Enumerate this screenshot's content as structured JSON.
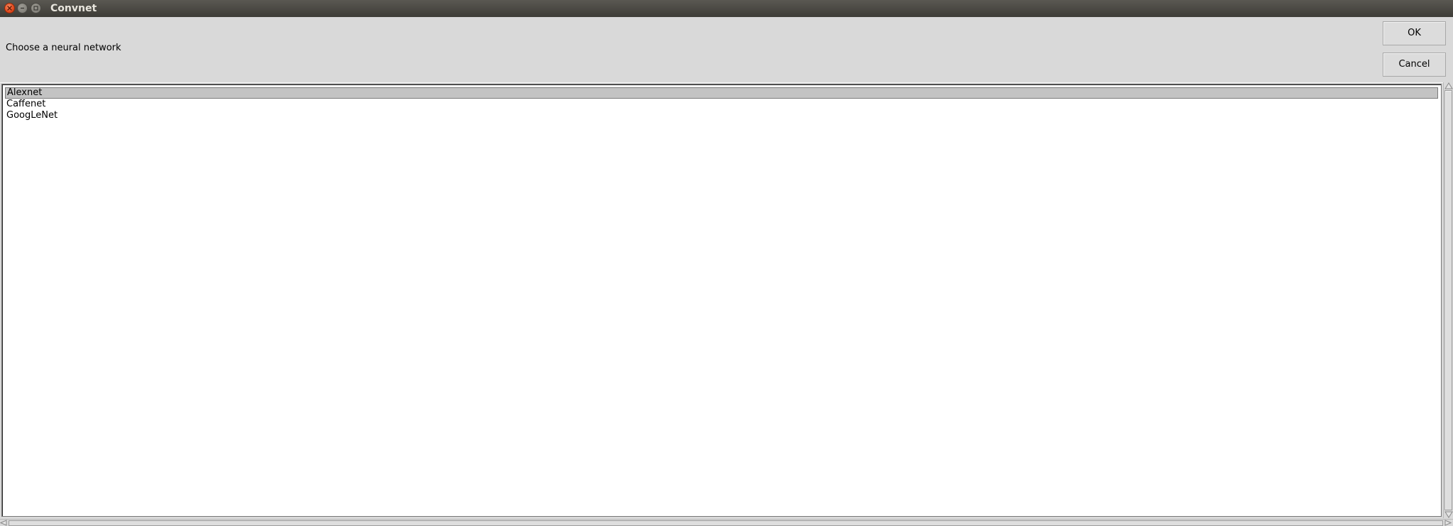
{
  "window": {
    "title": "Convnet",
    "controls": [
      "close-icon",
      "minimize-icon",
      "maximize-icon"
    ]
  },
  "dialog": {
    "prompt": "Choose a neural network",
    "ok_label": "OK",
    "cancel_label": "Cancel"
  },
  "list": {
    "items": [
      {
        "label": "Alexnet",
        "selected": true
      },
      {
        "label": "Caffenet",
        "selected": false
      },
      {
        "label": "GoogLeNet",
        "selected": false
      }
    ]
  },
  "colors": {
    "titlebar": "#3d3c37",
    "close_button": "#e2491d",
    "selection": "#c3c3c3",
    "background": "#d9d9d9"
  }
}
